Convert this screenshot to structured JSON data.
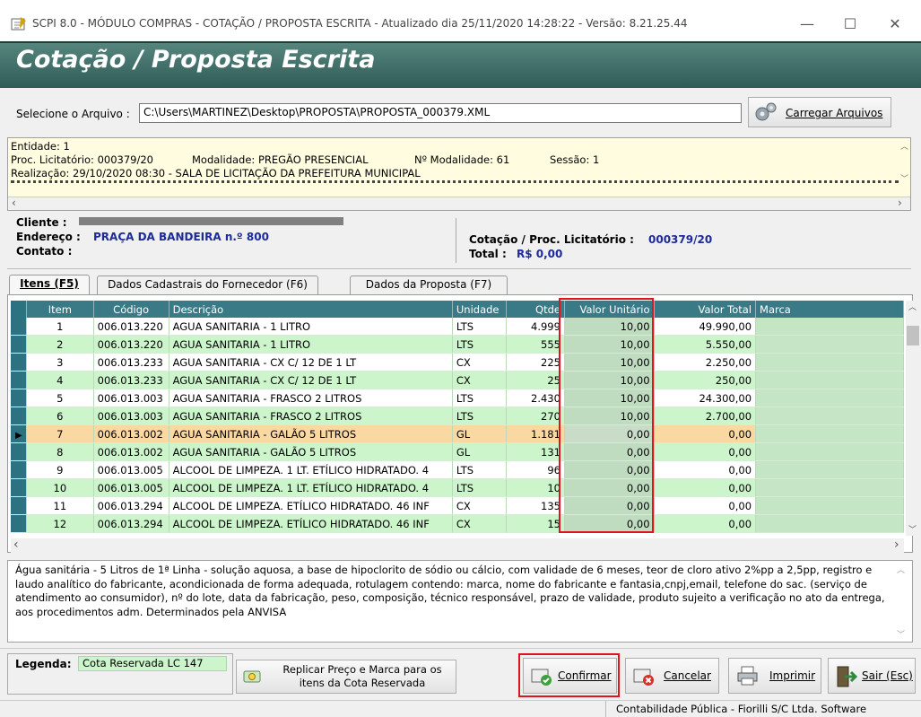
{
  "window": {
    "title": "SCPI 8.0 - MÓDULO COMPRAS - COTAÇÃO / PROPOSTA ESCRITA - Atualizado dia 25/11/2020 14:28:22 - Versão: 8.21.25.44",
    "minimize": "—",
    "maximize": "☐",
    "close": "✕"
  },
  "banner": {
    "title": "Cotação / Proposta Escrita"
  },
  "file": {
    "label": "Selecione o Arquivo :",
    "path": "C:\\Users\\MARTINEZ\\Desktop\\PROPOSTA\\PROPOSTA_000379.XML",
    "load_button": "Carregar Arquivos"
  },
  "info": {
    "entidade": "Entidade: 1",
    "proc": "Proc. Licitatório: 000379/20",
    "modalidade": "Modalidade: PREGÃO PRESENCIAL",
    "nmodalidade": "Nº Modalidade: 61",
    "sessao": "Sessão: 1",
    "realizacao": "Realização: 29/10/2020 08:30 - SALA DE LICITAÇÃO DA PREFEITURA MUNICIPAL"
  },
  "cliente": {
    "cliente_label": "Cliente :",
    "endereco_label": "Endereço :",
    "endereco_value": "PRAÇA DA BANDEIRA  n.º 800",
    "contato_label": "Contato :",
    "cotacao_label": "Cotação / Proc. Licitatório :",
    "cotacao_value": "000379/20",
    "total_label": "Total :",
    "total_value": "R$ 0,00"
  },
  "tabs": [
    {
      "label": "Itens (F5)"
    },
    {
      "label": "Dados Cadastrais do Fornecedor (F6)"
    },
    {
      "label": "Dados da Proposta (F7)"
    }
  ],
  "grid": {
    "columns": [
      "Item",
      "Código",
      "Descrição",
      "Unidade",
      "Qtde",
      "Valor Unitário",
      "Valor Total",
      "Marca"
    ],
    "rows": [
      {
        "item": "1",
        "codigo": "006.013.220",
        "descricao": "AGUA SANITARIA - 1 LITRO",
        "unidade": "LTS",
        "qtde": "4.999",
        "vu": "10,00",
        "vt": "49.990,00"
      },
      {
        "item": "2",
        "codigo": "006.013.220",
        "descricao": "AGUA SANITARIA - 1 LITRO",
        "unidade": "LTS",
        "qtde": "555",
        "vu": "10,00",
        "vt": "5.550,00"
      },
      {
        "item": "3",
        "codigo": "006.013.233",
        "descricao": "AGUA SANITARIA - CX C/ 12 DE 1 LT",
        "unidade": "CX",
        "qtde": "225",
        "vu": "10,00",
        "vt": "2.250,00"
      },
      {
        "item": "4",
        "codigo": "006.013.233",
        "descricao": "AGUA SANITARIA - CX C/ 12 DE 1 LT",
        "unidade": "CX",
        "qtde": "25",
        "vu": "10,00",
        "vt": "250,00"
      },
      {
        "item": "5",
        "codigo": "006.013.003",
        "descricao": "AGUA SANITARIA - FRASCO 2 LITROS",
        "unidade": "LTS",
        "qtde": "2.430",
        "vu": "10,00",
        "vt": "24.300,00"
      },
      {
        "item": "6",
        "codigo": "006.013.003",
        "descricao": "AGUA SANITARIA - FRASCO 2 LITROS",
        "unidade": "LTS",
        "qtde": "270",
        "vu": "10,00",
        "vt": "2.700,00"
      },
      {
        "item": "7",
        "codigo": "006.013.002",
        "descricao": "AGUA SANITARIA - GALÃO 5 LITROS",
        "unidade": "GL",
        "qtde": "1.181",
        "vu": "0,00",
        "vt": "0,00"
      },
      {
        "item": "8",
        "codigo": "006.013.002",
        "descricao": "AGUA SANITARIA - GALÃO 5 LITROS",
        "unidade": "GL",
        "qtde": "131",
        "vu": "0,00",
        "vt": "0,00"
      },
      {
        "item": "9",
        "codigo": "006.013.005",
        "descricao": "ALCOOL DE LIMPEZA. 1 LT. ETÍLICO HIDRATADO. 4",
        "unidade": "LTS",
        "qtde": "96",
        "vu": "0,00",
        "vt": "0,00"
      },
      {
        "item": "10",
        "codigo": "006.013.005",
        "descricao": "ALCOOL DE LIMPEZA. 1 LT. ETÍLICO HIDRATADO. 4",
        "unidade": "LTS",
        "qtde": "10",
        "vu": "0,00",
        "vt": "0,00"
      },
      {
        "item": "11",
        "codigo": "006.013.294",
        "descricao": "ALCOOL DE LIMPEZA. ETÍLICO HIDRATADO. 46 INF",
        "unidade": "CX",
        "qtde": "135",
        "vu": "0,00",
        "vt": "0,00"
      },
      {
        "item": "12",
        "codigo": "006.013.294",
        "descricao": "ALCOOL DE LIMPEZA. ETÍLICO HIDRATADO. 46 INF",
        "unidade": "CX",
        "qtde": "15",
        "vu": "0,00",
        "vt": "0,00"
      }
    ]
  },
  "description": "Água sanitária - 5 Litros de 1ª Linha - solução aquosa, a base de hipoclorito de sódio ou cálcio, com validade de 6 meses, teor de cloro ativo 2%pp a 2,5pp, registro e laudo analítico do fabricante, acondicionada de forma adequada, rotulagem contendo: marca, nome do fabricante e fantasia,cnpj,email, telefone do sac. (serviço de atendimento ao consumidor), nº do lote, data da fabricação, peso, composição, técnico responsável, prazo de validade, produto sujeito a verificação no ato da entrega, aos procedimentos adm. Determinados pela ANVISA",
  "legend": {
    "label": "Legenda:",
    "value": "Cota Reservada LC 147"
  },
  "buttons": {
    "replicar": "Replicar Preço e Marca para os itens da Cota Reservada",
    "confirmar": "Confirmar",
    "cancelar": "Cancelar",
    "imprimir": "Imprimir",
    "sair": "Sair (Esc)"
  },
  "status": "Contabilidade Pública - Fiorilli S/C Ltda. Software"
}
